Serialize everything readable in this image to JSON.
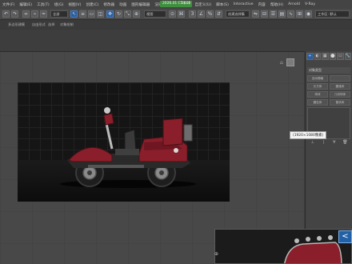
{
  "window": {
    "badge": "2026.01 C5 (...)",
    "build": "3800"
  },
  "menu": [
    "文件(F)",
    "编辑(E)",
    "工具(T)",
    "组(G)",
    "视图(V)",
    "创建(C)",
    "修改器",
    "动画",
    "图形编辑器",
    "渲染(R)",
    "Civil View",
    "自定义(U)",
    "脚本(S)",
    "Interactive",
    "内容",
    "帮助(H)",
    "Arnold",
    "V-Ray"
  ],
  "toolbar": {
    "selection_filter": "全部",
    "named_selection": "创建选择集",
    "workspace": "工作区: 默认"
  },
  "ribbon": {
    "tab1": "多边形建模",
    "tab2": "自由形式",
    "tab3": "选择",
    "tab4": "对象绘制"
  },
  "command_panel": {
    "tabs": [
      "+",
      "◐",
      "▦",
      "⬤",
      "▭",
      "🔧"
    ],
    "rollout_title": "对象类型",
    "buttons": [
      "自动栅格",
      "",
      "长方体",
      "圆锥体",
      "球体",
      "几何球体",
      "圆柱体",
      "管状体"
    ]
  },
  "tooltip": {
    "text": "(1920×1080像素)"
  },
  "overlay": {
    "button_label": "<"
  },
  "colors": {
    "accent": "#2d5f9e",
    "badge": "#3f8f3f",
    "viewport_bg": "#484848",
    "render_bg": "#151515",
    "vehicle_body": "#8a1f2b"
  }
}
